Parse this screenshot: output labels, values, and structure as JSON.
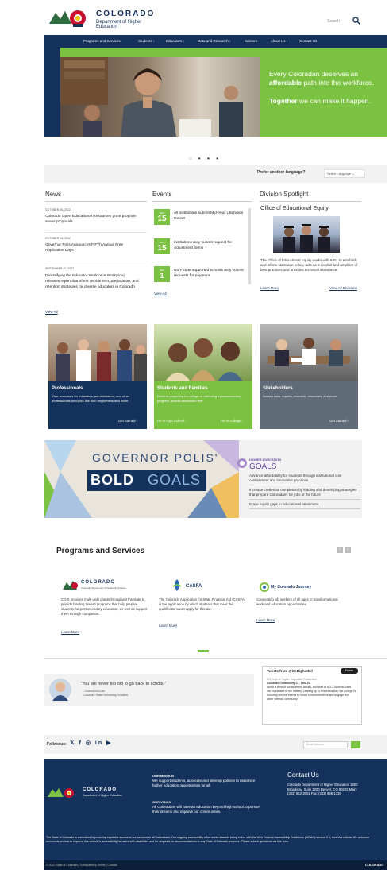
{
  "header": {
    "brand_title": "COLORADO",
    "brand_subtitle": "Department of Higher Education",
    "search_label": "Search"
  },
  "nav": {
    "items": [
      "Programs and Services",
      "Students ›",
      "Educators ›",
      "Data and Research ›",
      "Careers",
      "About Us ›",
      "Contact Us"
    ]
  },
  "hero": {
    "line1_pre": "Every Coloradan deserves an ",
    "line1_bold": "affordable",
    "line1_post": " path into the workforce.",
    "line2_bold": "Together",
    "line2_post": " we can make it happen.",
    "dots": "○ ● ● ●"
  },
  "language": {
    "question": "Prefer another language?",
    "select": "Select Language ⌄"
  },
  "news": {
    "heading": "News",
    "items": [
      {
        "date": "OCTOBER 26, 2022",
        "title": "Colorado Open Educational Resources grant program seeks proposals"
      },
      {
        "date": "OCTOBER 13, 2022",
        "title": "Governor Polis Announces FIFTh Annual Free Application Days"
      },
      {
        "date": "SEPTEMBER 30, 2022",
        "title": "Diversifying the Educator Workforce Workgroup releases report that offers recruitment, preparation, and retention strategies for diverse educators in Colorado"
      }
    ],
    "view_all": "View All"
  },
  "events": {
    "heading": "Events",
    "items": [
      {
        "month": "NOV",
        "day": "15",
        "title": "All institutions submit Mid-Year Utilization Report"
      },
      {
        "month": "NOV",
        "day": "15",
        "title": "Institutions may submit request for Adjustment forms"
      },
      {
        "month": "DEC",
        "day": "1",
        "title": "Non-State supported schools may submit requests for payment"
      }
    ],
    "view_all": "View All"
  },
  "spotlight": {
    "heading": "Division Spotlight",
    "title": "Office of Educational Equity",
    "body": "The Office of Educational Equity works with IHEs to establish and inform statewide policy, acts as a conduit and amplifier of best practices and provides technical assistance.",
    "learn_more": "Learn More",
    "view_all": "View All Divisions"
  },
  "cards": [
    {
      "title": "Professionals",
      "desc": "View resources for educators, administrators, and other professionals on topics like loan forgiveness and more.",
      "foot_right": "Get Started ›",
      "color": "#14325c"
    },
    {
      "title": "Students and Families",
      "desc": "Whether preparing for college or attending a postsecondary program, access resources here.",
      "foot_left": "I'm In High School ›",
      "foot_right": "I'm In College ›",
      "color": "#7cc242"
    },
    {
      "title": "Stakeholders",
      "desc": "Access data, reports, research, resources, and more.",
      "foot_right": "Get Started ›",
      "color": "#5f6b76"
    }
  ],
  "goals": {
    "title1": "GOVERNOR POLIS'",
    "bold": "BOLD",
    "goals_word": "GOALS",
    "sub1": "HIGHER EDUCATION",
    "sub2": "GOALS",
    "items": [
      "Advance affordability for students through institutional cost containment and innovative practices",
      "Increase credential completion by leading and developing strategies that prepare Coloradans for jobs of the future",
      "Erase equity gaps in educational attainment"
    ]
  },
  "programs": {
    "heading": "Programs and Services",
    "prev": "‹",
    "next": "›",
    "items": [
      {
        "name": "COLORADO",
        "sub": "Colorado Opportunity Scholarship Initiative",
        "desc": "COSI provides multi-year grants throughout the state to provide funding toward programs that help prepare students for postsecondary education, as well as support them through completion.",
        "link": "Learn More"
      },
      {
        "name": "CASFA",
        "desc": "The Colorado Application for State Financial Aid (CASFA) is the application by which students that meet the qualifications can apply for this aid.",
        "link": "Learn More"
      },
      {
        "name": "My Colorado Journey",
        "desc": "Connecting job seekers of all ages to transformational work and education opportunities",
        "link": "Learn More"
      }
    ]
  },
  "testimonial": {
    "quote": "\"You are never too old to go back to school.\"",
    "author": "– Donna McCain",
    "school": "Colorado State University Student"
  },
  "tweets": {
    "title": "Tweets from @CoHigherEd",
    "follow": "Follow",
    "retweet_note": "CO Dept of Higher Education Retweeted",
    "account": "Colorado Community C... Nov 10",
    "body": "About a third of our students, faculty, and staff at #CCCNursesGrads are connected to the military. Leading up to #VeteransDay, the college is honoring several events to honor servicemembers and engage the wider veteran community."
  },
  "follow": {
    "label": "Follow us:",
    "social": "𝕏 f ◎ in ▶",
    "email_placeholder": "Email Address",
    "go": "›"
  },
  "footer": {
    "brand": "COLORADO",
    "brand_sub": "Department of Higher Education",
    "mission_label": "OUR MISSION",
    "mission": "We support students, advocate and develop policies to maximize higher education opportunities for all.",
    "vision_label": "OUR VISION",
    "vision": "All Coloradans will have an education beyond high school to pursue their dreams and improve our communities.",
    "contact_title": "Contact Us",
    "contact_body": "Colorado Department of Higher Education 1600 Broadway, Suite 2200 Denver, CO 80202 Main: (303) 862-3001 Fax: (303) 996-1329",
    "note": "The State of Colorado is committed to providing equitable access to our services to all Coloradans. Our ongoing accessibility effort works towards being in line with the Web Content Accessibility Guidelines (WCAG) version 2.1, level AA criteria. We welcome comments on how to improve this website's accessibility for users with disabilities and for requests for accommodations to any State of Colorado services. Please submit questions via this form.",
    "bottom": "© 2022 State of Colorado | Transparency Online | Contact",
    "bottom_right": "COLORADO"
  }
}
